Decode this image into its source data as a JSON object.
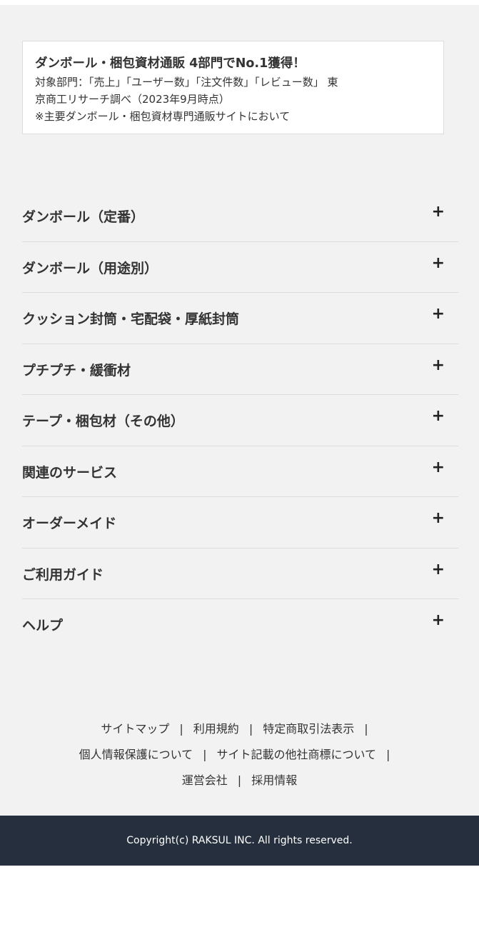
{
  "notice": {
    "title": "ダンボール・梱包資材通販 4部門でNo.1獲得！",
    "line1": "対象部門：「売上」「ユーザー数」「注文件数」「レビュー数」 東",
    "line2": "京商工リサーチ調べ（2023年9月時点）",
    "line3": "※主要ダンボール・梱包資材専門通販サイトにおいて"
  },
  "accordion": {
    "expand_symbol": "+",
    "items": [
      {
        "label": "ダンボール（定番）"
      },
      {
        "label": "ダンボール（用途別）"
      },
      {
        "label": "クッション封筒・宅配袋・厚紙封筒"
      },
      {
        "label": "プチプチ・緩衝材"
      },
      {
        "label": "テープ・梱包材（その他）"
      },
      {
        "label": "関連のサービス"
      },
      {
        "label": "オーダーメイド"
      },
      {
        "label": "ご利用ガイド"
      },
      {
        "label": "ヘルプ"
      }
    ]
  },
  "footer": {
    "separator": "|",
    "links": {
      "sitemap": "サイトマップ",
      "terms": "利用規約",
      "commercial_law": "特定商取引法表示",
      "privacy": "個人情報保護について",
      "trademarks": "サイト記載の他社商標について",
      "company": "運営会社",
      "recruit": "採用情報"
    },
    "copyright": "Copyright(c) RAKSUL INC. All rights reserved."
  },
  "colors": {
    "page_background": "#f2f2f2",
    "footer_bar": "#252f3d",
    "text": "#333333"
  }
}
